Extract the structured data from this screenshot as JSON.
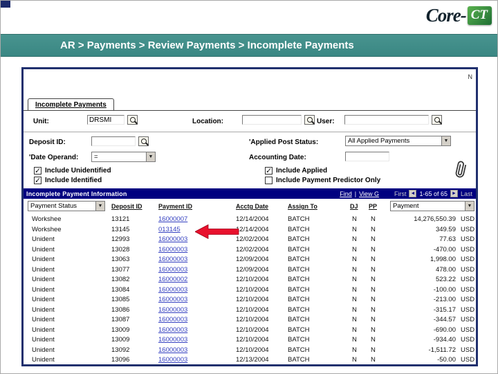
{
  "logo": {
    "text_core": "Core-",
    "text_ct": "CT"
  },
  "banner": {
    "breadcrumb": "AR > Payments > Review Payments > Incomplete Payments"
  },
  "icons": {
    "dropdown_arrow": "▼",
    "prev_arrow": "◄",
    "next_arrow": "►"
  },
  "screen": {
    "corner_fragment": "N",
    "tab_label": "Incomplete Payments",
    "fields": {
      "unit": {
        "label": "Unit:",
        "value": "DRSMI"
      },
      "location": {
        "label": "Location:",
        "value": ""
      },
      "user": {
        "label": "User:",
        "value": ""
      },
      "deposit_id": {
        "label": "Deposit ID:",
        "value": ""
      },
      "applied_post_status": {
        "label": "'Applied Post Status:",
        "value": "All Applied Payments"
      },
      "date_operand": {
        "label": "'Date Operand:",
        "value": "="
      },
      "accounting_date": {
        "label": "Accounting Date:",
        "value": ""
      }
    },
    "checkboxes": [
      {
        "label": "Include Unidentified",
        "checked": true
      },
      {
        "label": "Include Applied",
        "checked": true
      },
      {
        "label": "Include Identified",
        "checked": true
      },
      {
        "label": "Include Payment Predictor Only",
        "checked": false
      }
    ],
    "grid": {
      "title": "Incomplete Payment Information",
      "nav": {
        "find": "Find",
        "separator": "|",
        "view": "View G",
        "first": "First",
        "range": "1-65 of 65",
        "last": "Last"
      },
      "status_filter": "Payment Status",
      "payment_filter": "Payment",
      "columns": {
        "deposit": "Deposit ID",
        "payment": "Payment ID",
        "date": "Acctg Date",
        "assign": "Assign To",
        "dj": "DJ",
        "pp": "PP"
      },
      "rows": [
        {
          "status": "Workshee",
          "deposit_id": "13121",
          "payment_id": "16000007",
          "acctg_date": "12/14/2004",
          "assign_to": "BATCH",
          "dj": "N",
          "pp": "N",
          "amount": "14,276,550.39",
          "currency": "USD"
        },
        {
          "status": "Workshee",
          "deposit_id": "13145",
          "payment_id": "013145",
          "acctg_date": "12/14/2004",
          "assign_to": "BATCH",
          "dj": "N",
          "pp": "N",
          "amount": "349.59",
          "currency": "USD"
        },
        {
          "status": "Unident",
          "deposit_id": "12993",
          "payment_id": "16000003",
          "acctg_date": "12/02/2004",
          "assign_to": "BATCH",
          "dj": "N",
          "pp": "N",
          "amount": "77.63",
          "currency": "USD"
        },
        {
          "status": "Unident",
          "deposit_id": "13028",
          "payment_id": "16000003",
          "acctg_date": "12/02/2004",
          "assign_to": "BATCH",
          "dj": "N",
          "pp": "N",
          "amount": "-470.00",
          "currency": "USD"
        },
        {
          "status": "Unident",
          "deposit_id": "13063",
          "payment_id": "16000003",
          "acctg_date": "12/09/2004",
          "assign_to": "BATCH",
          "dj": "N",
          "pp": "N",
          "amount": "1,998.00",
          "currency": "USD"
        },
        {
          "status": "Unident",
          "deposit_id": "13077",
          "payment_id": "16000003",
          "acctg_date": "12/09/2004",
          "assign_to": "BATCH",
          "dj": "N",
          "pp": "N",
          "amount": "478.00",
          "currency": "USD"
        },
        {
          "status": "Unident",
          "deposit_id": "13082",
          "payment_id": "16000002",
          "acctg_date": "12/10/2004",
          "assign_to": "BATCH",
          "dj": "N",
          "pp": "N",
          "amount": "523.22",
          "currency": "USD"
        },
        {
          "status": "Unident",
          "deposit_id": "13084",
          "payment_id": "16000003",
          "acctg_date": "12/10/2004",
          "assign_to": "BATCH",
          "dj": "N",
          "pp": "N",
          "amount": "-100.00",
          "currency": "USD"
        },
        {
          "status": "Unident",
          "deposit_id": "13085",
          "payment_id": "16000003",
          "acctg_date": "12/10/2004",
          "assign_to": "BATCH",
          "dj": "N",
          "pp": "N",
          "amount": "-213.00",
          "currency": "USD"
        },
        {
          "status": "Unident",
          "deposit_id": "13086",
          "payment_id": "16000003",
          "acctg_date": "12/10/2004",
          "assign_to": "BATCH",
          "dj": "N",
          "pp": "N",
          "amount": "-315.17",
          "currency": "USD"
        },
        {
          "status": "Unident",
          "deposit_id": "13087",
          "payment_id": "16000003",
          "acctg_date": "12/10/2004",
          "assign_to": "BATCH",
          "dj": "N",
          "pp": "N",
          "amount": "-344.57",
          "currency": "USD"
        },
        {
          "status": "Unident",
          "deposit_id": "13009",
          "payment_id": "16000003",
          "acctg_date": "12/10/2004",
          "assign_to": "BATCH",
          "dj": "N",
          "pp": "N",
          "amount": "-690.00",
          "currency": "USD"
        },
        {
          "status": "Unident",
          "deposit_id": "13009",
          "payment_id": "16000003",
          "acctg_date": "12/10/2004",
          "assign_to": "BATCH",
          "dj": "N",
          "pp": "N",
          "amount": "-934.40",
          "currency": "USD"
        },
        {
          "status": "Unident",
          "deposit_id": "13092",
          "payment_id": "16000003",
          "acctg_date": "12/10/2004",
          "assign_to": "BATCH",
          "dj": "N",
          "pp": "N",
          "amount": "-1,511.72",
          "currency": "USD"
        },
        {
          "status": "Unident",
          "deposit_id": "13096",
          "payment_id": "16000003",
          "acctg_date": "12/13/2004",
          "assign_to": "BATCH",
          "dj": "N",
          "pp": "N",
          "amount": "-50.00",
          "currency": "USD"
        }
      ]
    }
  }
}
